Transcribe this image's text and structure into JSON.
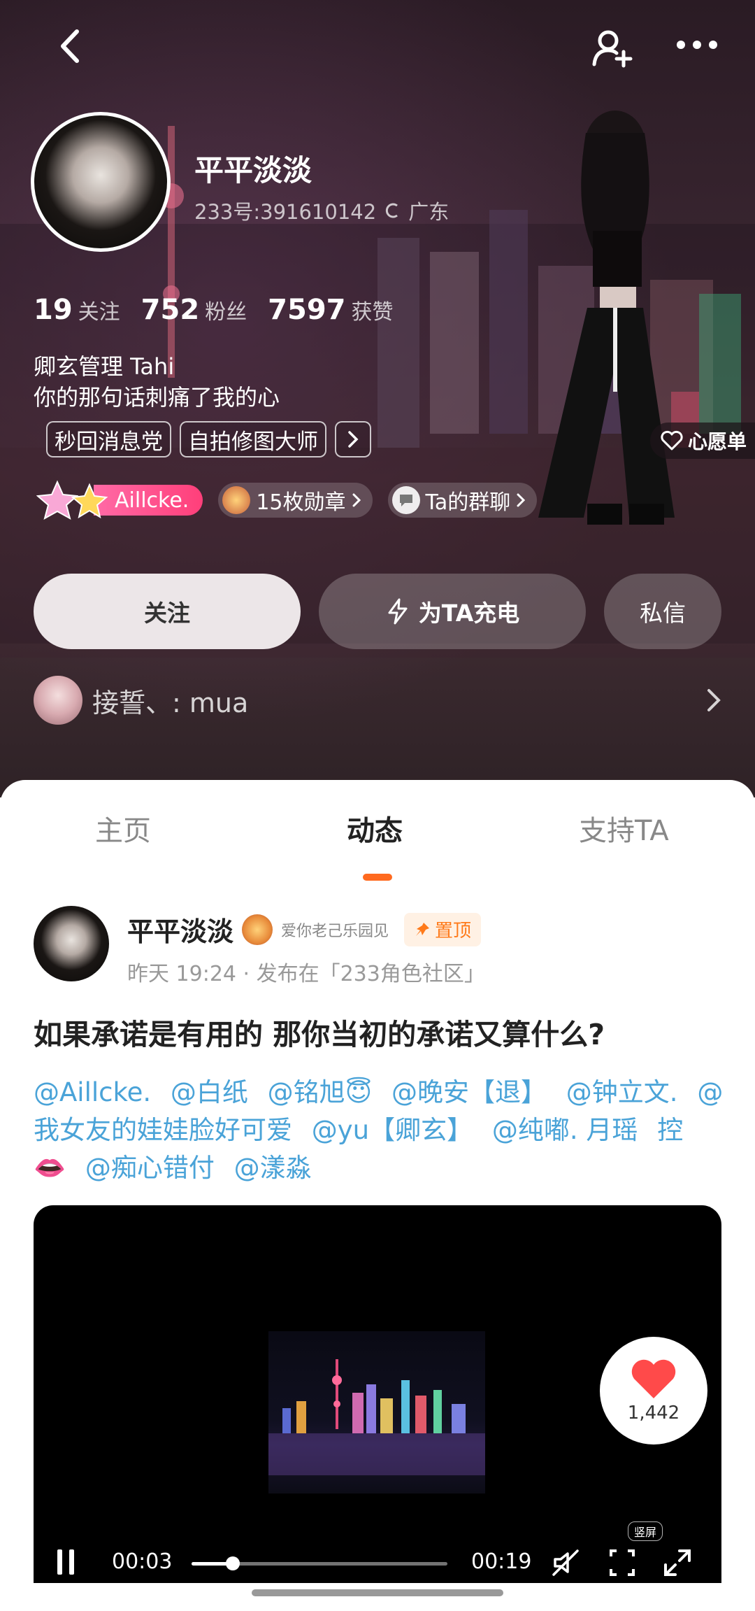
{
  "profile": {
    "nickname": "平平淡淡",
    "id_line": "233号:391610142",
    "location": "广东",
    "stats": [
      {
        "num": "19",
        "label": "关注"
      },
      {
        "num": "752",
        "label": "粉丝"
      },
      {
        "num": "7597",
        "label": "获赞"
      }
    ],
    "bio_line1": "卿玄管理 Tahi",
    "bio_line2": "你的那句话刺痛了我的心",
    "tags": [
      "秒回消息党",
      "自拍修图大师"
    ],
    "wishlist": "心愿单",
    "vip_name": "Aillcke.",
    "medals": "15枚勋章",
    "group_chat": "Ta的群聊",
    "follow_btn": "关注",
    "charge_btn": "为TA充电",
    "message_btn": "私信",
    "friend_text": "接誓、: mua"
  },
  "tabs": [
    "主页",
    "动态",
    "支持TA"
  ],
  "post": {
    "author": "平平淡淡",
    "medal_text": "爱你老己乐园见",
    "pinned": "置顶",
    "meta": "昨天 19:24 · 发布在「233角色社区」",
    "title": "如果承诺是有用的 那你当初的承诺又算什么?",
    "mentions": [
      "@Aillcke.",
      "@白纸",
      "@铭旭😇",
      "@晚安【退】",
      "@钟立文.",
      "@我女友的娃娃脸好可爱",
      "@yu【卿玄】",
      "@纯嘟. 月瑶",
      "控👄",
      "@痴心错付",
      "@漾淼"
    ]
  },
  "video": {
    "current": "00:03",
    "duration": "00:19",
    "progress": 0.16,
    "likes": "1,442",
    "mode_label": "竖屏"
  },
  "colors": {
    "accent": "#ff6a1f",
    "mention": "#4aa3d8",
    "vip": "#ff3f7a"
  }
}
